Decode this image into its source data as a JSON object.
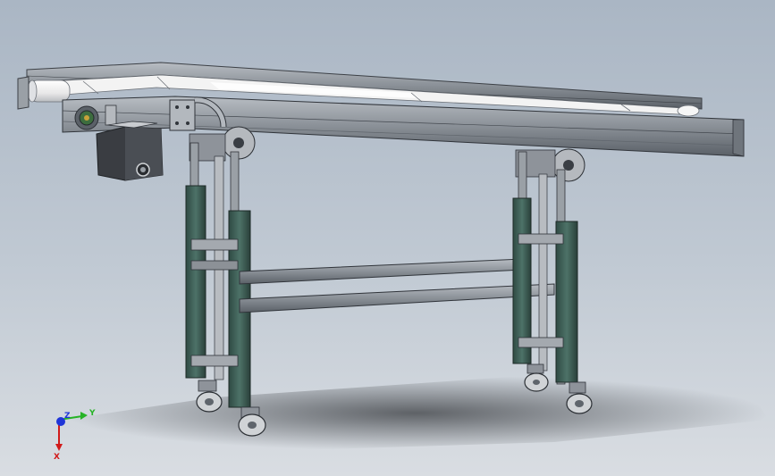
{
  "viewport": {
    "background_top": "#aab6c4",
    "background_bottom": "#d9dde2"
  },
  "model": {
    "kind": "belt-conveyor-assembly",
    "frame_color": "#8e9399",
    "frame_dark": "#4a4f56",
    "leg_color": "#3f5f57",
    "belt_color": "#f4f4f4",
    "motor_color": "#3a3d42"
  },
  "triad": {
    "x_label": "X",
    "y_label": "Y",
    "z_label": "Z",
    "x_color": "#d11a1a",
    "y_color": "#27b327",
    "z_color": "#1f35d8"
  }
}
